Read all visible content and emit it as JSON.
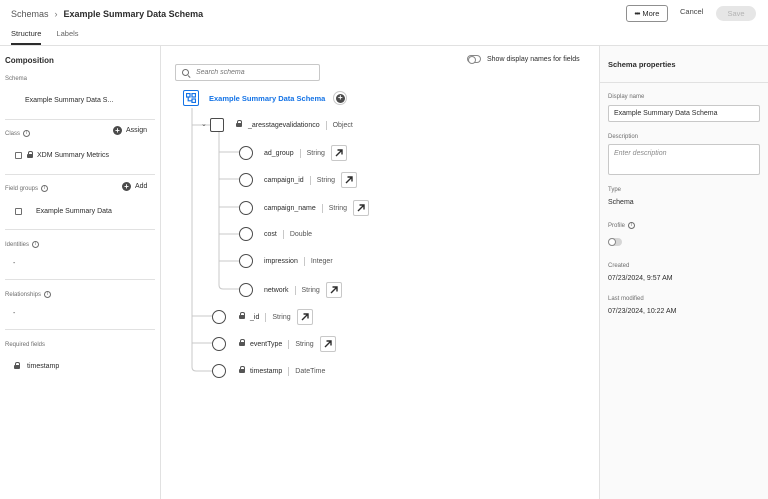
{
  "header": {
    "breadcrumb_root": "Schemas",
    "breadcrumb_current": "Example Summary Data Schema",
    "more_label": "More",
    "cancel_label": "Cancel",
    "save_label": "Save",
    "tabs": [
      {
        "label": "Structure",
        "active": true
      },
      {
        "label": "Labels",
        "active": false
      }
    ]
  },
  "composition": {
    "title": "Composition",
    "schema_label": "Schema",
    "schema_value": "Example Summary Data S...",
    "class_label": "Class",
    "assign_label": "Assign",
    "class_value": "XDM Summary Metrics",
    "field_groups_label": "Field groups",
    "add_label": "Add",
    "field_group_value": "Example Summary Data",
    "identities_label": "Identities",
    "identities_value": "-",
    "relationships_label": "Relationships",
    "relationships_value": "-",
    "required_fields_label": "Required fields",
    "required_field_value": "timestamp"
  },
  "canvas": {
    "search_placeholder": "Search schema",
    "display_names_toggle_label": "Show display names for fields",
    "display_names_toggle_on": false,
    "root_name": "Example Summary Data Schema",
    "object_field": {
      "name": "_aresstagevalidationco",
      "type": "Object",
      "locked": true
    },
    "children": [
      {
        "name": "ad_group",
        "type": "String",
        "link": true
      },
      {
        "name": "campaign_id",
        "type": "String",
        "link": true
      },
      {
        "name": "campaign_name",
        "type": "String",
        "link": true
      },
      {
        "name": "cost",
        "type": "Double",
        "link": false
      },
      {
        "name": "impression",
        "type": "Integer",
        "link": false
      },
      {
        "name": "network",
        "type": "String",
        "link": true
      }
    ],
    "top_fields": [
      {
        "name": "_id",
        "type": "String",
        "link": true,
        "locked": true
      },
      {
        "name": "eventType",
        "type": "String",
        "link": true,
        "locked": true
      },
      {
        "name": "timestamp",
        "type": "DateTime",
        "link": false,
        "locked": true
      }
    ]
  },
  "properties": {
    "title": "Schema properties",
    "display_name_label": "Display name",
    "display_name_value": "Example Summary Data Schema",
    "description_label": "Description",
    "description_placeholder": "Enter description",
    "type_label": "Type",
    "type_value": "Schema",
    "profile_label": "Profile",
    "profile_enabled": false,
    "created_label": "Created",
    "created_value": "07/23/2024, 9:57 AM",
    "modified_label": "Last modified",
    "modified_value": "07/23/2024, 10:22 AM"
  }
}
